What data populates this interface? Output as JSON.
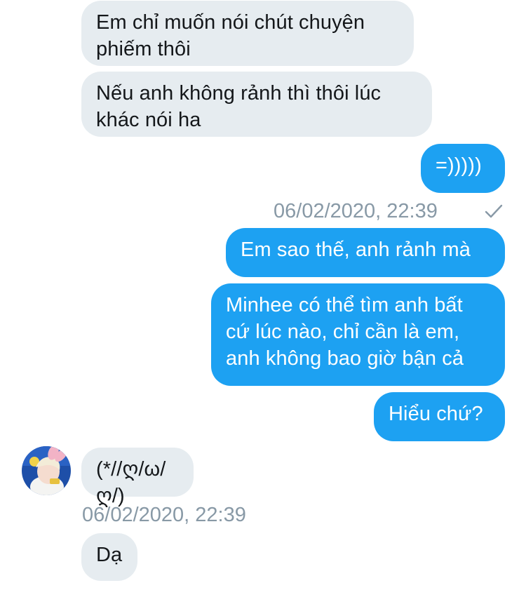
{
  "conversation": {
    "messages": [
      {
        "direction": "incoming",
        "text": "Em chỉ muốn nói chút chuyện\nphiếm thôi"
      },
      {
        "direction": "incoming",
        "text": "Nếu anh không rảnh thì thôi lúc\nkhác nói ha"
      },
      {
        "direction": "outgoing",
        "text": "=)))))"
      },
      {
        "direction": "outgoing",
        "text": "Em sao thế, anh rảnh mà"
      },
      {
        "direction": "outgoing",
        "text": "Minhee có thể tìm anh bất\ncứ lúc nào, chỉ cần là em,\nanh không bao giờ bận cả"
      },
      {
        "direction": "outgoing",
        "text": "Hiểu chứ?"
      },
      {
        "direction": "incoming",
        "text": "(*//ღ/ω/ღ/)"
      },
      {
        "direction": "incoming",
        "text": "Dạ"
      }
    ],
    "outgoing_timestamp": "06/02/2020, 22:39",
    "outgoing_status_icon": "checkmark-icon",
    "incoming_timestamp": "06/02/2020, 22:39",
    "avatar_icon": "contact-avatar"
  },
  "colors": {
    "incoming_bubble": "#e6ecf0",
    "outgoing_bubble": "#1da1f2",
    "timestamp": "#8899a6"
  }
}
